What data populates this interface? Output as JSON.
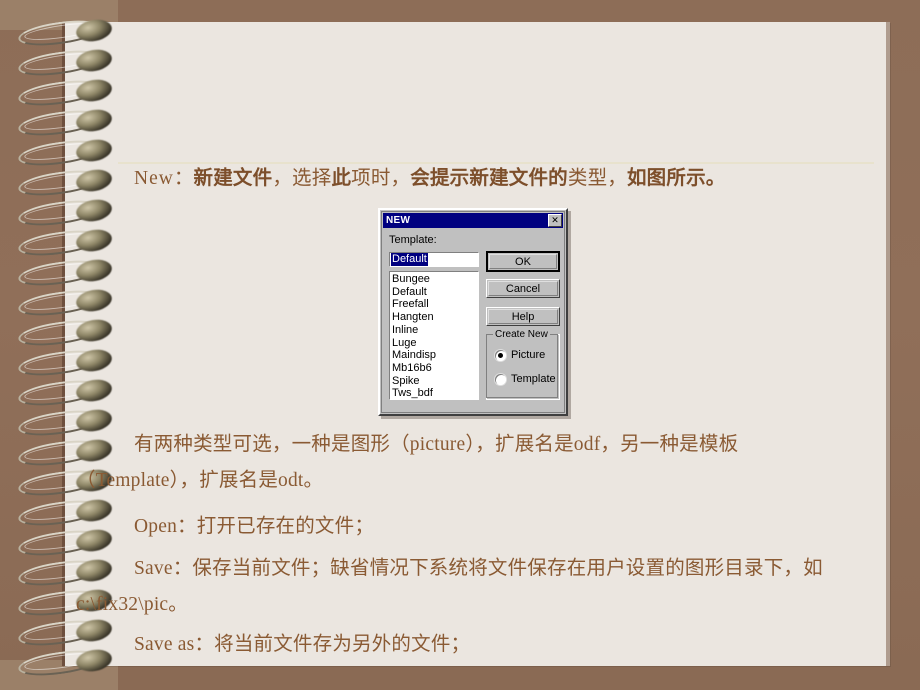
{
  "slide": {
    "theme": {
      "frame_color": "#8b6b55",
      "frame_light_color": "#9b8068",
      "page_color": "#ebe6e0",
      "text_color": "#8a5a33",
      "divider_color": "#e8e2cd",
      "spine_color": "#6e4f3d"
    }
  },
  "body": {
    "line_new": {
      "latin": "New",
      "colon": "：",
      "bold1": "新建文件",
      "reg1": "，选择",
      "bold2": "此",
      "reg2": "项时，",
      "bold3": "会提示新建文件的",
      "reg3": "类型，",
      "bold4": "如图所示。"
    },
    "line_two_a": "有两种类型可选，一种是图形（picture），扩展名是odf，另一种是模板",
    "line_two_b": "（Template），扩展名是odt。",
    "line_open": "Open：打开已存在的文件；",
    "line_save_a": "Save：保存当前文件；缺省情况下系统将文件保存在用户设置的图形目录下，如",
    "line_save_b": "c:\\fix32\\pic。",
    "line_saveas": "Save as：将当前文件存为另外的文件；"
  },
  "dialog": {
    "title": "NEW",
    "close_glyph": "✕",
    "template_label": "Template:",
    "edit_value": "Default",
    "list_items": [
      "Bungee",
      "Default",
      "Freefall",
      "Hangten",
      "Inline",
      "Luge",
      "Maindisp",
      "Mb16b6",
      "Spike",
      "Tws_bdf"
    ],
    "buttons": {
      "ok": "OK",
      "cancel": "Cancel",
      "help": "Help"
    },
    "create_new": {
      "group_label": "Create New",
      "options": [
        {
          "label": "Picture",
          "selected": true
        },
        {
          "label": "Template",
          "selected": false
        }
      ]
    }
  }
}
